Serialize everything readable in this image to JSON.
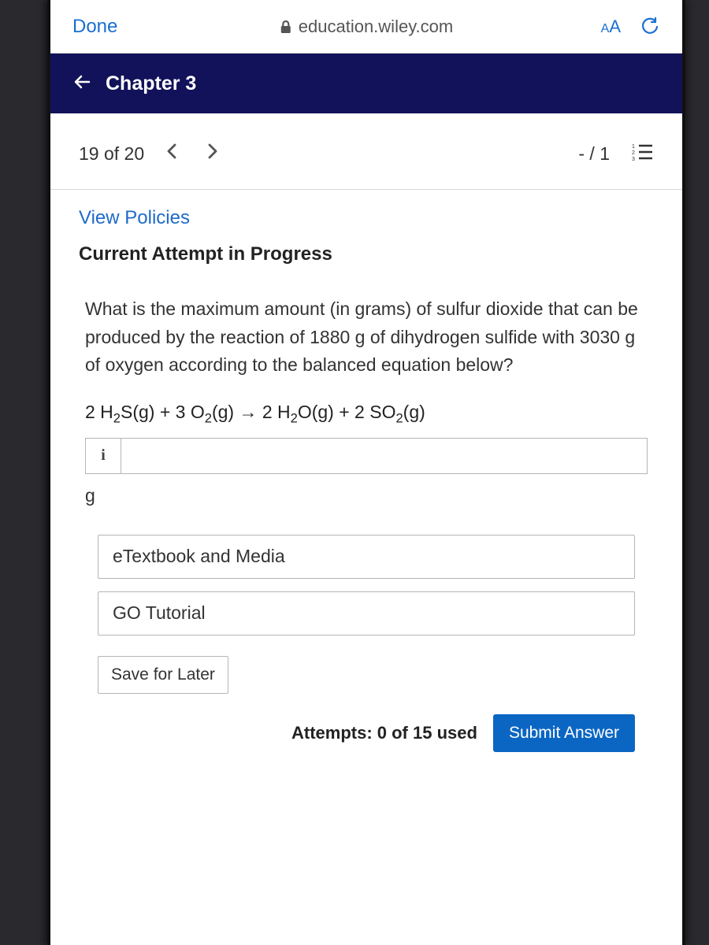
{
  "safari": {
    "done": "Done",
    "url": "education.wiley.com",
    "aa": "AA"
  },
  "chapter": {
    "title": "Chapter 3"
  },
  "nav": {
    "count": "19 of 20",
    "score": "- / 1"
  },
  "policies": {
    "link": "View Policies",
    "status": "Current Attempt in Progress"
  },
  "question": {
    "text": "What is the maximum amount (in grams) of sulfur dioxide that can be produced by the reaction of 1880 g of dihydrogen sulfide with 3030 g of oxygen according to the balanced equation below?",
    "unit": "g",
    "info_icon": "i"
  },
  "buttons": {
    "etextbook": "eTextbook and Media",
    "tutorial": "GO Tutorial",
    "save": "Save for Later",
    "submit": "Submit Answer"
  },
  "attempts": "Attempts: 0 of 15 used"
}
